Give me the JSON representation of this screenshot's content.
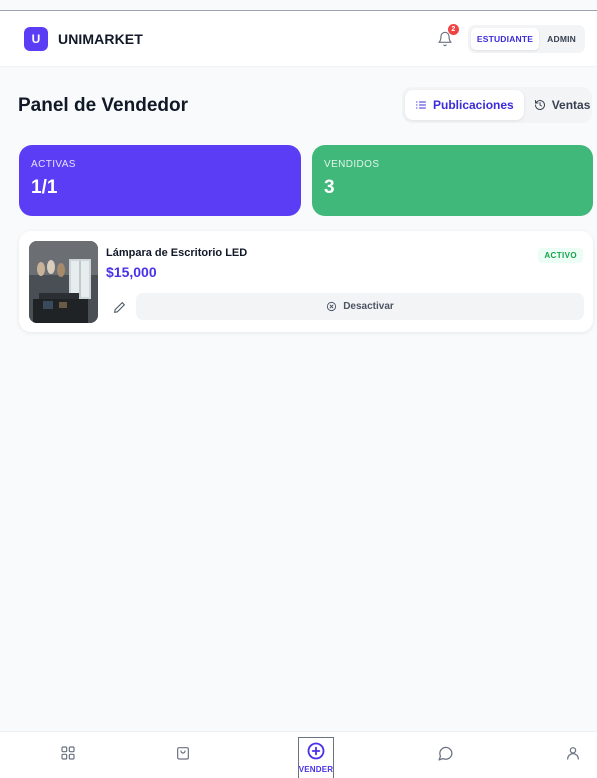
{
  "app": {
    "logo_letter": "U",
    "brand": "UNIMARKET",
    "notifications_count": "2",
    "roles": [
      "ESTUDIANTE",
      "ADMIN"
    ],
    "active_role": "ESTUDIANTE"
  },
  "page": {
    "title": "Panel de Vendedor",
    "tabs": [
      {
        "label": "Publicaciones",
        "icon": "list-icon",
        "active": true
      },
      {
        "label": "Ventas",
        "icon": "history-icon",
        "active": false
      }
    ]
  },
  "stats": {
    "active": {
      "label": "ACTIVAS",
      "value": "1/1",
      "color": "#5b3df5"
    },
    "sold": {
      "label": "VENDIDOS",
      "value": "3",
      "color": "#3fb87a"
    }
  },
  "listings": [
    {
      "title": "Lámpara de Escritorio LED",
      "price": "$15,000",
      "status": "ACTIVO",
      "deactivate_label": "Desactivar"
    }
  ],
  "bottom_nav": {
    "items": [
      {
        "name": "home",
        "icon": "grid-icon"
      },
      {
        "name": "shop",
        "icon": "bag-icon"
      },
      {
        "name": "sell",
        "icon": "plus-circle-icon",
        "label": "VENDER",
        "active": true
      },
      {
        "name": "chat",
        "icon": "chat-bubble-icon"
      },
      {
        "name": "profile",
        "icon": "user-icon"
      }
    ]
  },
  "colors": {
    "accent": "#5b3df5",
    "success": "#3fb87a",
    "danger": "#ef4444"
  }
}
